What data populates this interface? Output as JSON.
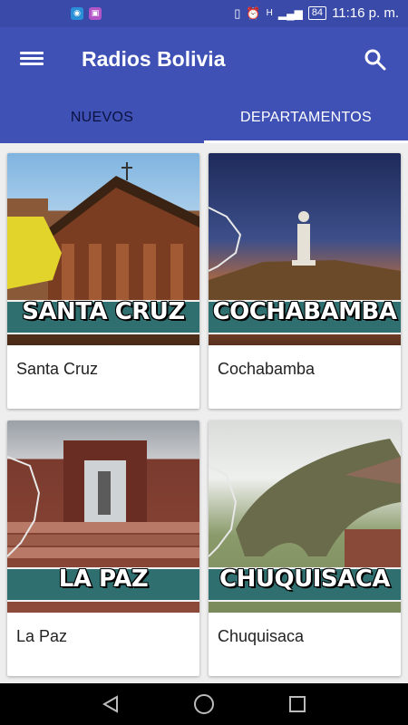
{
  "status_bar": {
    "time": "11:16 p. m.",
    "battery": "84",
    "network": "H"
  },
  "app_bar": {
    "title": "Radios Bolivia",
    "menu_icon": "hamburger-menu-icon",
    "search_icon": "search-icon"
  },
  "tabs": [
    {
      "label": "NUEVOS",
      "selected": true
    },
    {
      "label": "DEPARTAMENTOS",
      "selected": false
    }
  ],
  "cards": [
    {
      "banner": "SANTA CRUZ",
      "name": "Santa Cruz"
    },
    {
      "banner": "COCHABAMBA",
      "name": "Cochabamba"
    },
    {
      "banner": "LA PAZ",
      "name": "La Paz"
    },
    {
      "banner": "CHUQUISACA",
      "name": "Chuquisaca"
    }
  ],
  "colors": {
    "primary": "#3f51b5",
    "status_bar": "#3a4aa8",
    "banner": "#2f6f6f"
  }
}
